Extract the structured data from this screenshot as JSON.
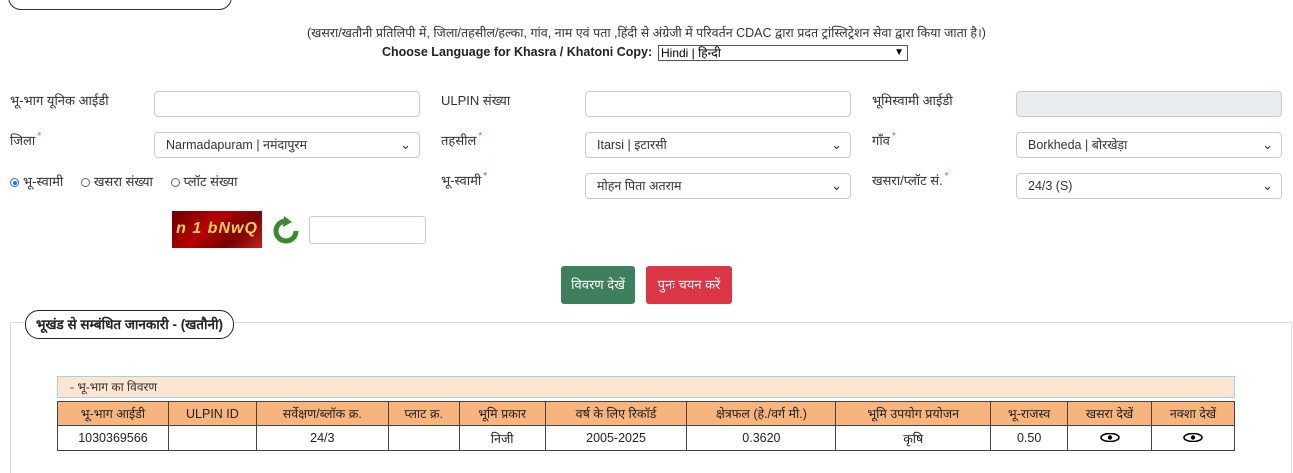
{
  "header": {
    "note": "(खसरा/खतौनी प्रतिलिपी में, जिला/तहसील/हल्का, गांव, नाम एवं पता ,हिंदी से अंग्रेजी में परिवर्तन CDAC द्वारा प्रदत ट्रांस्लिट्रेशन सेवा द्वारा किया जाता है।)",
    "language_label": "Choose Language for Khasra / Khatoni Copy:",
    "language_value": "Hindi | हिन्दी"
  },
  "form": {
    "unique_id_label": "भू-भाग यूनिक आईडी",
    "ulpin_label": "ULPIN संख्या",
    "owner_id_label": "भूमिस्वामी आईडी",
    "district_label": "जिला",
    "district_value": "Narmadapuram | नमंदापुरम",
    "tehsil_label": "तहसील",
    "tehsil_value": "Itarsi | इटारसी",
    "village_label": "गाँव",
    "village_value": "Borkheda | बोरखेड़ा",
    "radio_owner": "भू-स्वामी",
    "radio_khasra": "खसरा संख्या",
    "radio_plot": "प्लॉट संख्या",
    "owner_label": "भू-स्वामी",
    "owner_value": "मोहन पिता अतराम",
    "khasra_label": "खसरा/प्लॉट सं.",
    "khasra_value": "24/3 (S)",
    "required_mark": "*",
    "captcha_text": "n 1 bNwQ",
    "view_button": "विवरण देखें",
    "reset_button": "पुनः चयन करें"
  },
  "section": {
    "legend": "भूखंड से सम्बंधित जानकारी -  (खतौनी)",
    "sub_heading": "- भू-भाग का विवरण",
    "columns": [
      "भू-भाग आईडी",
      "ULPIN ID",
      "सर्वेक्षण/ब्लॉक क्र.",
      "प्लाट क्र.",
      "भूमि प्रकार",
      "वर्ष के लिए रिकॉर्ड",
      "क्षेत्रफल (हे./वर्ग मी.)",
      "भूमि उपयोग प्रयोजन",
      "भू-राजस्व",
      "खसरा देखें",
      "नक्शा देखें"
    ],
    "rows": [
      [
        "1030369566",
        "",
        "24/3",
        "",
        "निजी",
        "2005-2025",
        "0.3620",
        "कृषि",
        "0.50"
      ]
    ]
  },
  "icons": {
    "refresh": "refresh-icon",
    "view": "eye-icon",
    "dropdown": "chevron-down-icon"
  },
  "colors": {
    "green_button": "#3e7f5e",
    "red_button": "#dc3545",
    "table_header": "#f7b57d",
    "sub_heading_bg": "#fde5d2"
  }
}
